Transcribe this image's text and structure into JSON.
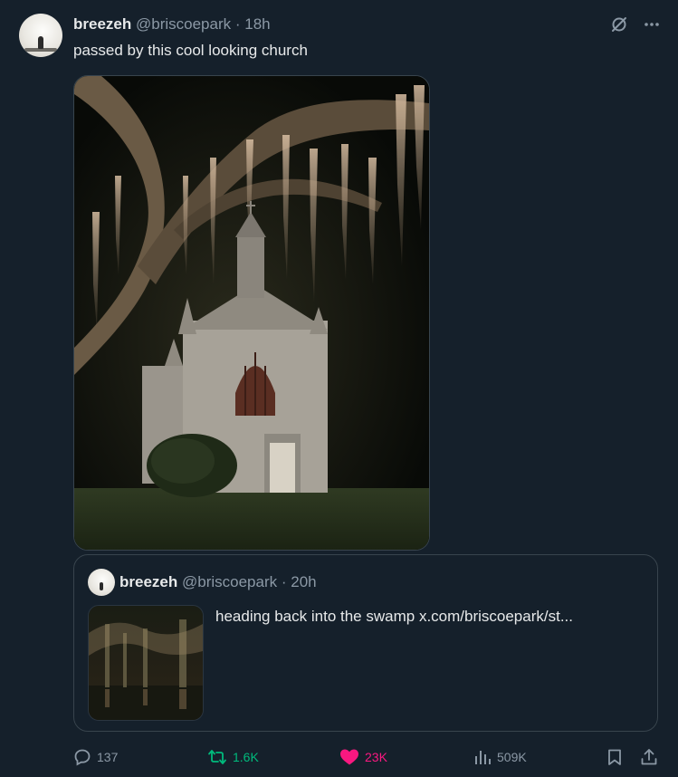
{
  "tweet": {
    "author_name": "breezeh",
    "author_handle": "@briscoepark",
    "separator": "·",
    "time": "18h",
    "text": "passed by this cool looking church"
  },
  "quote": {
    "author_name": "breezeh",
    "author_handle": "@briscoepark",
    "separator": "·",
    "time": "20h",
    "text": "heading back into the swamp",
    "link": "x.com/briscoepark/st..."
  },
  "actions": {
    "replies": "137",
    "retweets": "1.6K",
    "likes": "23K",
    "views": "509K"
  },
  "colors": {
    "background": "#15202b",
    "border": "#38444d",
    "muted": "#8b98a5",
    "retweet_active": "#00ba7c",
    "like_active": "#f91880"
  },
  "icons": {
    "grok": "grok-icon",
    "more": "more-icon",
    "reply": "reply-icon",
    "retweet": "retweet-icon",
    "like": "heart-icon",
    "views": "views-icon",
    "bookmark": "bookmark-icon",
    "share": "share-icon"
  }
}
